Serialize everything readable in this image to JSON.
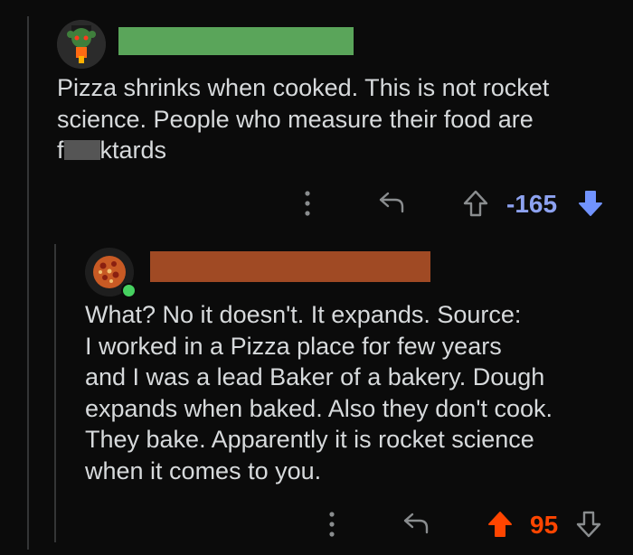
{
  "comments": [
    {
      "author_color": "#5aa55a",
      "text_before": "Pizza shrinks when cooked. This is not rocket\nscience. People who measure their food are\nf",
      "text_after": "ktards",
      "score": "-165",
      "score_color": "#8da2f0",
      "vote_state": "downvoted",
      "icons": {
        "more": "more-options-icon",
        "reply": "reply-icon",
        "up": "upvote-icon",
        "down": "downvote-icon"
      }
    },
    {
      "author_color": "#a04a24",
      "text": "What?  No it doesn't.  It expands.  Source:\nI worked in a Pizza place for few years\nand I was a lead Baker of a bakery.  Dough\nexpands when baked.  Also they don't cook.\nThey bake.   Apparently it is rocket science\nwhen it comes to you.",
      "score": "95",
      "score_color": "#ff4500",
      "vote_state": "upvoted",
      "online": true,
      "icons": {
        "more": "more-options-icon",
        "reply": "reply-icon",
        "up": "upvote-icon",
        "down": "downvote-icon"
      }
    }
  ],
  "colors": {
    "background": "#0b0b0b",
    "text": "#d7dadc",
    "icon": "#8a8d8f",
    "downvote": "#7193ff",
    "upvote": "#ff4500"
  }
}
